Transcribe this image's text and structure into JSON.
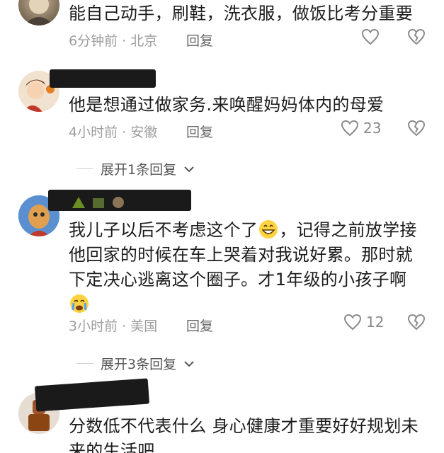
{
  "comments": [
    {
      "text": "能自己动手，刷鞋，洗衣服，做饭比考分重要",
      "time_location": "6分钟前 · 北京",
      "reply_label": "回复",
      "likes": ""
    },
    {
      "text": "他是想通过做家务.来唤醒妈妈体内的母爱",
      "time_location": "4小时前 · 安徽",
      "reply_label": "回复",
      "likes": "23",
      "expand_label": "展开1条回复"
    },
    {
      "text_line1_a": "我儿子以后不考虑这个了",
      "text_line1_b": "，记得之前放学接",
      "text_line2": "他回家的时候在车上哭着对我说好累。那时就",
      "text_line3": "下定决心逃离这个圈子。才1年级的小孩子啊",
      "time_location": "3小时前 · 美国",
      "reply_label": "回复",
      "likes": "12",
      "expand_label": "展开3条回复"
    },
    {
      "text_line1": "分数低不代表什么 身心健康才重要好好规划未",
      "text_line2": "来的生活吧"
    }
  ],
  "colors": {
    "meta_text": "#9e9e9e",
    "name_redaction": "#1a1a1a"
  }
}
